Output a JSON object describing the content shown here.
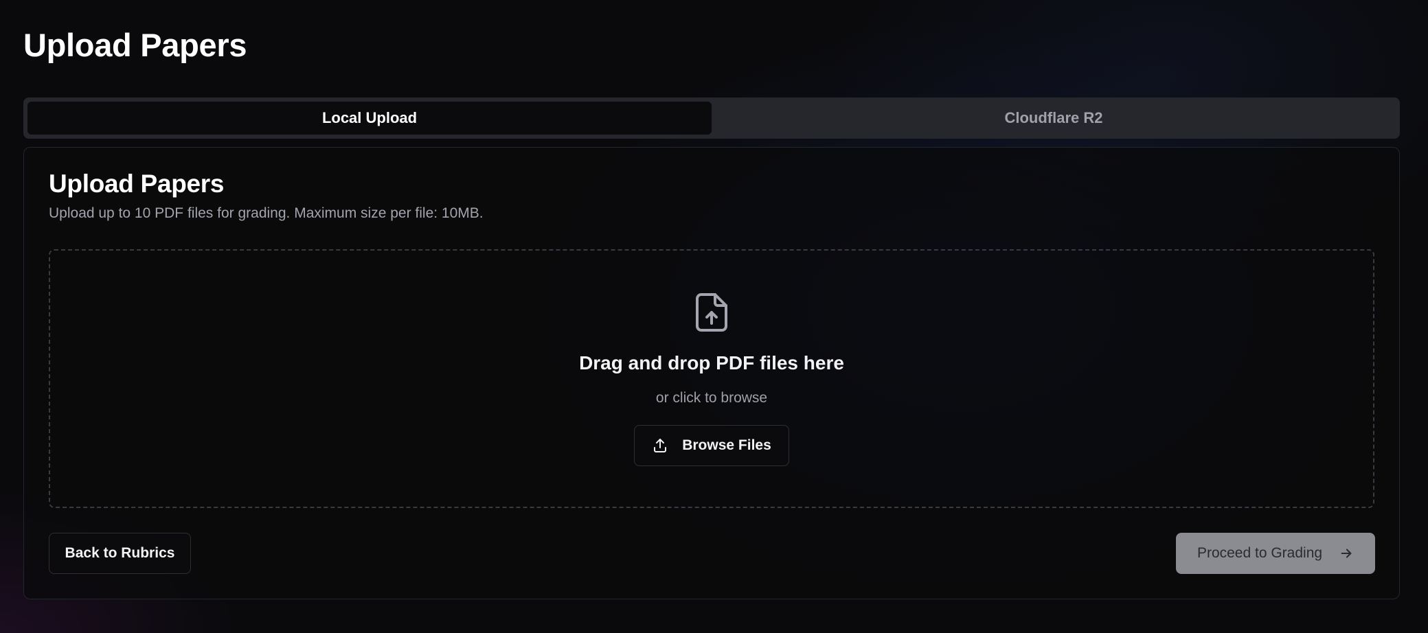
{
  "page": {
    "title": "Upload Papers"
  },
  "tabs": [
    {
      "label": "Local Upload",
      "active": true
    },
    {
      "label": "Cloudflare R2",
      "active": false
    }
  ],
  "card": {
    "title": "Upload Papers",
    "description": "Upload up to 10 PDF files for grading. Maximum size per file: 10MB."
  },
  "dropzone": {
    "icon": "file-upload-icon",
    "title": "Drag and drop PDF files here",
    "subtitle": "or click to browse",
    "browse_label": "Browse Files",
    "browse_icon": "upload-icon"
  },
  "footer": {
    "back_label": "Back to Rubrics",
    "proceed_label": "Proceed to Grading",
    "proceed_icon": "arrow-right-icon",
    "proceed_disabled": true
  },
  "colors": {
    "background": "#0a0a0c",
    "tab_bar": "#26272c",
    "active_tab": "#0b0b0e",
    "disabled_button": "#8b8c92"
  }
}
